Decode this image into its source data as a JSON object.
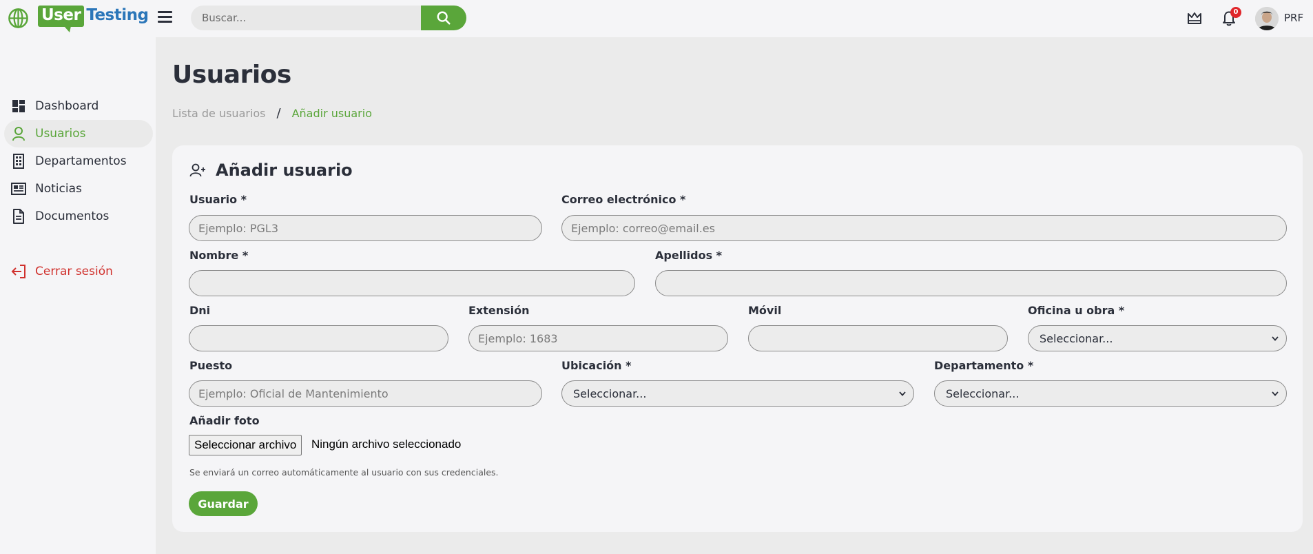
{
  "brand": {
    "logo_part1": "User",
    "logo_part2": "Testing",
    "accent": "#5aa63a",
    "logo_blue": "#2b76b9"
  },
  "header": {
    "search_placeholder": "Buscar...",
    "notifications_count": "0",
    "user_initials": "PRF"
  },
  "sidebar": {
    "items": [
      {
        "label": "Dashboard",
        "icon": "dashboard-icon",
        "active": false
      },
      {
        "label": "Usuarios",
        "icon": "user-icon",
        "active": true
      },
      {
        "label": "Departamentos",
        "icon": "building-icon",
        "active": false
      },
      {
        "label": "Noticias",
        "icon": "newspaper-icon",
        "active": false
      },
      {
        "label": "Documentos",
        "icon": "document-icon",
        "active": false
      }
    ],
    "logout_label": "Cerrar sesión"
  },
  "page": {
    "title": "Usuarios",
    "breadcrumb": [
      "Lista de usuarios",
      "/",
      "Añadir usuario"
    ]
  },
  "form": {
    "title": "Añadir usuario",
    "fields": {
      "usuario": {
        "label": "Usuario *",
        "placeholder": "Ejemplo: PGL3"
      },
      "correo": {
        "label": "Correo electrónico *",
        "placeholder": "Ejemplo: correo@email.es"
      },
      "nombre": {
        "label": "Nombre *",
        "placeholder": ""
      },
      "apellidos": {
        "label": "Apellidos *",
        "placeholder": ""
      },
      "dni": {
        "label": "Dni",
        "placeholder": ""
      },
      "extension": {
        "label": "Extensión",
        "placeholder": "Ejemplo: 1683"
      },
      "movil": {
        "label": "Móvil",
        "placeholder": ""
      },
      "oficina": {
        "label": "Oficina u obra *",
        "selected": "Seleccionar..."
      },
      "puesto": {
        "label": "Puesto",
        "placeholder": "Ejemplo: Oficial de Mantenimiento"
      },
      "ubicacion": {
        "label": "Ubicación *",
        "selected": "Seleccionar..."
      },
      "departamento": {
        "label": "Departamento *",
        "selected": "Seleccionar..."
      }
    },
    "photo_label": "Añadir foto",
    "file_button": "Seleccionar archivo",
    "file_status": "Ningún archivo seleccionado",
    "hint": "Se enviará un correo automáticamente al usuario con sus credenciales.",
    "save_label": "Guardar"
  }
}
